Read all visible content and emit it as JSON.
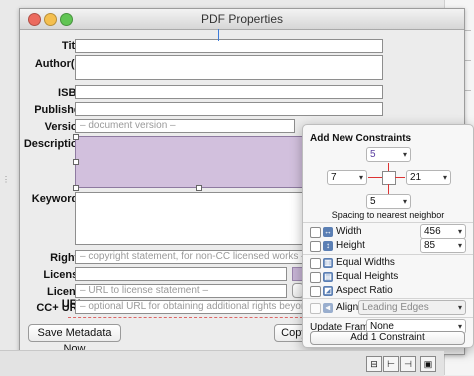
{
  "window": {
    "title": "PDF Properties"
  },
  "form": {
    "title_label": "Title:",
    "authors_label": "Author(s):",
    "isbn_label": "ISBN:",
    "publisher_label": "Publisher:",
    "version_label": "Version:",
    "version_placeholder": "– document version –",
    "description_label": "Description:",
    "keywords_label": "Keywords:",
    "rights_label": "Rights:",
    "rights_placeholder": "– copyright statement, for non-CC licensed works –",
    "license_label": "License:",
    "license_url_label": "License URL:",
    "license_url_placeholder": "– URL to license statement –",
    "cc_url_label": "CC+ URL:",
    "cc_url_placeholder": "– optional URL for obtaining additional rights beyond lic",
    "save_button": "Save Metadata Now",
    "copy_button": "Copy"
  },
  "constraints": {
    "header": "Add New Constraints",
    "top_value": "5",
    "left_value": "7",
    "right_value": "21",
    "bottom_value": "5",
    "spacing_note": "Spacing to nearest neighbor",
    "width_label": "Width",
    "width_value": "456",
    "height_label": "Height",
    "height_value": "85",
    "equal_widths": "Equal Widths",
    "equal_heights": "Equal Heights",
    "aspect_ratio": "Aspect Ratio",
    "align_label": "Align",
    "align_value": "Leading Edges",
    "update_frames_label": "Update Frames",
    "update_frames_value": "None",
    "add_button": "Add 1 Constraint",
    "accent_color": "#7a5ab5"
  }
}
